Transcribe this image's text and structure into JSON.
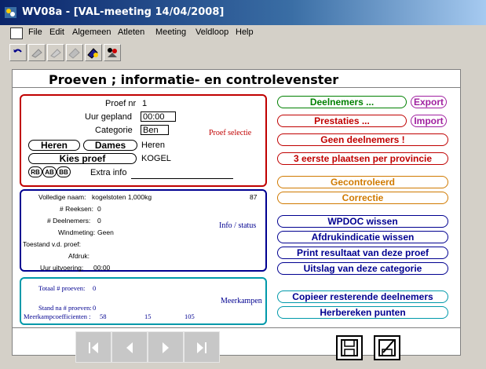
{
  "window": {
    "title": "WV08a - [VAL-meeting 14/04/2008]"
  },
  "menu": [
    "File",
    "Edit",
    "Algemeen",
    "Atleten",
    "Meeting",
    "Veldloop",
    "Help"
  ],
  "toolbar": [
    "undo-icon",
    "copy-icon",
    "paste-icon",
    "erase-icon",
    "people-icon"
  ],
  "header": {
    "title": "Proeven ; informatie- en controlevenster"
  },
  "proef": {
    "nr_label": "Proef nr",
    "nr_value": "1",
    "uur_label": "Uur gepland",
    "uur_value": "00:00",
    "cat_label": "Categorie",
    "cat_value": "Ben",
    "heren": "Heren",
    "dames": "Dames",
    "gender_value": "Heren",
    "kies": "Kies proef",
    "proef_value": "KOGEL",
    "extra_label": "Extra info",
    "extra_value": "",
    "badges": [
      "RB",
      "AB",
      "BB"
    ],
    "group_title": "Proef selectie"
  },
  "info": {
    "naam_label": "Volledige naam:",
    "naam_value": "kogelstoten 1,000kg",
    "naam_count": "87",
    "reeksen_label": "# Reeksen:",
    "reeksen_value": "0",
    "deelnemers_label": "# Deelnemers:",
    "deelnemers_value": "0",
    "wind_label": "Windmeting:",
    "wind_value": "Geen",
    "toestand_label": "Toestand v.d. proef:",
    "afdruk_label": "Afdruk:",
    "uitv_label": "Uur uitvoering:",
    "uitv_value": "00:00",
    "group_title": "Info / status"
  },
  "meerkamp": {
    "totaal_label": "Totaal # proeven:",
    "totaal_value": "0",
    "stand_label": "Stand na # proeven:",
    "stand_value": "0",
    "coef_label": "Meerkampcoefficienten :",
    "coef_values": [
      "58",
      "15",
      "105"
    ],
    "group_title": "Meerkampen"
  },
  "buttons": {
    "deelnemers": "Deelnemers ...",
    "export": "Export",
    "prestaties": "Prestaties ...",
    "import": "Import",
    "geen": "Geen deelnemers !",
    "drie": "3 eerste plaatsen per provincie",
    "gecontroleerd": "Gecontroleerd",
    "correctie": "Correctie",
    "wpdoc": "WPDOC wissen",
    "afdruk": "Afdrukindicatie wissen",
    "print": "Print resultaat van deze proef",
    "uitslag": "Uitslag van deze categorie",
    "copieer": "Copieer resterende deelnemers",
    "herbereken": "Herbereken punten"
  },
  "colors": {
    "red": "#c00000",
    "blue": "#000090",
    "green": "#008000",
    "orange": "#d07a00",
    "purple": "#a020a0",
    "teal": "#0099aa"
  }
}
